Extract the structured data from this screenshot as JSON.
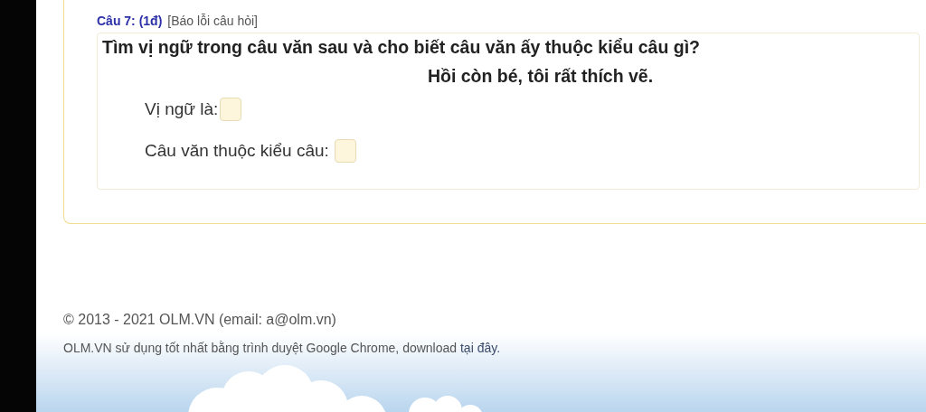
{
  "question": {
    "number": "Câu 7: (1đ)",
    "report_link": "[Báo lỗi câu hỏi]",
    "prompt": "Tìm vị ngữ trong câu văn sau và cho biết câu văn ấy thuộc kiểu câu gì?",
    "sentence": "Hồi còn bé, tôi rất thích vẽ.",
    "blanks": [
      {
        "label": "Vị ngữ là:"
      },
      {
        "label": "Câu văn thuộc kiểu câu:"
      }
    ]
  },
  "footer": {
    "copyright": "© 2013 - 2021 OLM.VN (email: a@olm.vn)",
    "note": "OLM.VN sử dụng tốt nhất bằng trình duyệt Google Chrome, download",
    "link": "tại đây."
  }
}
